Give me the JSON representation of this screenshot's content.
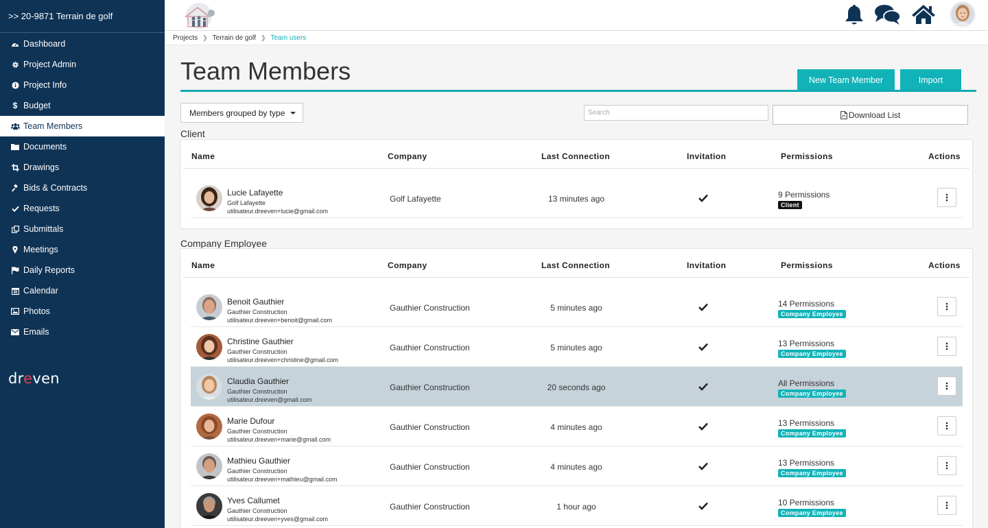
{
  "project": {
    "title": ">> 20-9871 Terrain de golf"
  },
  "sidebar": {
    "items": [
      {
        "label": "Dashboard",
        "icon": "dashboard-icon"
      },
      {
        "label": "Project Admin",
        "icon": "gear-icon"
      },
      {
        "label": "Project Info",
        "icon": "info-icon"
      },
      {
        "label": "Budget",
        "icon": "dollar-icon"
      },
      {
        "label": "Team Members",
        "icon": "users-icon",
        "active": true
      },
      {
        "label": "Documents",
        "icon": "folder-icon"
      },
      {
        "label": "Drawings",
        "icon": "crop-icon"
      },
      {
        "label": "Bids & Contracts",
        "icon": "gavel-icon"
      },
      {
        "label": "Requests",
        "icon": "check-icon"
      },
      {
        "label": "Submittals",
        "icon": "copy-icon"
      },
      {
        "label": "Meetings",
        "icon": "map-marker-icon"
      },
      {
        "label": "Daily Reports",
        "icon": "flag-icon"
      },
      {
        "label": "Calendar",
        "icon": "calendar-icon"
      },
      {
        "label": "Photos",
        "icon": "image-icon"
      },
      {
        "label": "Emails",
        "icon": "envelope-icon"
      }
    ],
    "logo_text_pre": "dr",
    "logo_text_dot": "e",
    "logo_text_post": "ven"
  },
  "breadcrumb": {
    "items": [
      "Projects",
      "Terrain de golf"
    ],
    "current": "Team users"
  },
  "header": {
    "title": "Team Members",
    "new_button": "New Team Member",
    "import_button": "Import"
  },
  "toolbar": {
    "group_select": "Members grouped by type",
    "search_placeholder": "Search",
    "download": "Download List"
  },
  "columns": {
    "name": "Name",
    "company": "Company",
    "last": "Last Connection",
    "invitation": "Invitation",
    "permissions": "Permissions",
    "actions": "Actions"
  },
  "colors": {
    "sidebar": "#0f3355",
    "accent": "#11b3b8",
    "client_badge": "#111111",
    "highlight_row": "#c6d3da"
  },
  "groups": [
    {
      "label": "Client",
      "members": [
        {
          "name": "Lucie Lafayette",
          "company_small": "Golf Lafayette",
          "email": "utilisateur.dreeven+lucie@gmail.com",
          "company": "Golf Lafayette",
          "last": "13 minutes ago",
          "permissions": "9 Permissions",
          "badge": "Client"
        }
      ]
    },
    {
      "label": "Company Employee",
      "members": [
        {
          "name": "Benoit Gauthier",
          "company_small": "Gauthier Construction",
          "email": "utilisateur.dreeven+benoit@gmail.com",
          "company": "Gauthier Construction",
          "last": "5 minutes ago",
          "permissions": "14 Permissions",
          "badge": "Company Employee"
        },
        {
          "name": "Christine Gauthier",
          "company_small": "Gauthier Construction",
          "email": "utilisateur.dreeven+christine@gmail.com",
          "company": "Gauthier Construction",
          "last": "5 minutes ago",
          "permissions": "13 Permissions",
          "badge": "Company Employee"
        },
        {
          "name": "Claudia Gauthier",
          "company_small": "Gauthier Construction",
          "email": "utilisateur.dreeven@gmail.com",
          "company": "Gauthier Construction",
          "last": "20 seconds ago",
          "permissions": "All Permissions",
          "badge": "Company Employee",
          "highlighted": true
        },
        {
          "name": "Marie Dufour",
          "company_small": "Gauthier Construction",
          "email": "utilisateur.dreeven+marie@gmail.com",
          "company": "Gauthier Construction",
          "last": "4 minutes ago",
          "permissions": "13 Permissions",
          "badge": "Company Employee"
        },
        {
          "name": "Mathieu Gauthier",
          "company_small": "Gauthier Construction",
          "email": "utilisateur.dreeven+mathieu@gmail.com",
          "company": "Gauthier Construction",
          "last": "4 minutes ago",
          "permissions": "13 Permissions",
          "badge": "Company Employee"
        },
        {
          "name": "Yves Callumet",
          "company_small": "Gauthier Construction",
          "email": "utilisateur.dreeven+yves@gmail.com",
          "company": "Gauthier Construction",
          "last": "1 hour ago",
          "permissions": "10 Permissions",
          "badge": "Company Employee"
        }
      ]
    }
  ]
}
